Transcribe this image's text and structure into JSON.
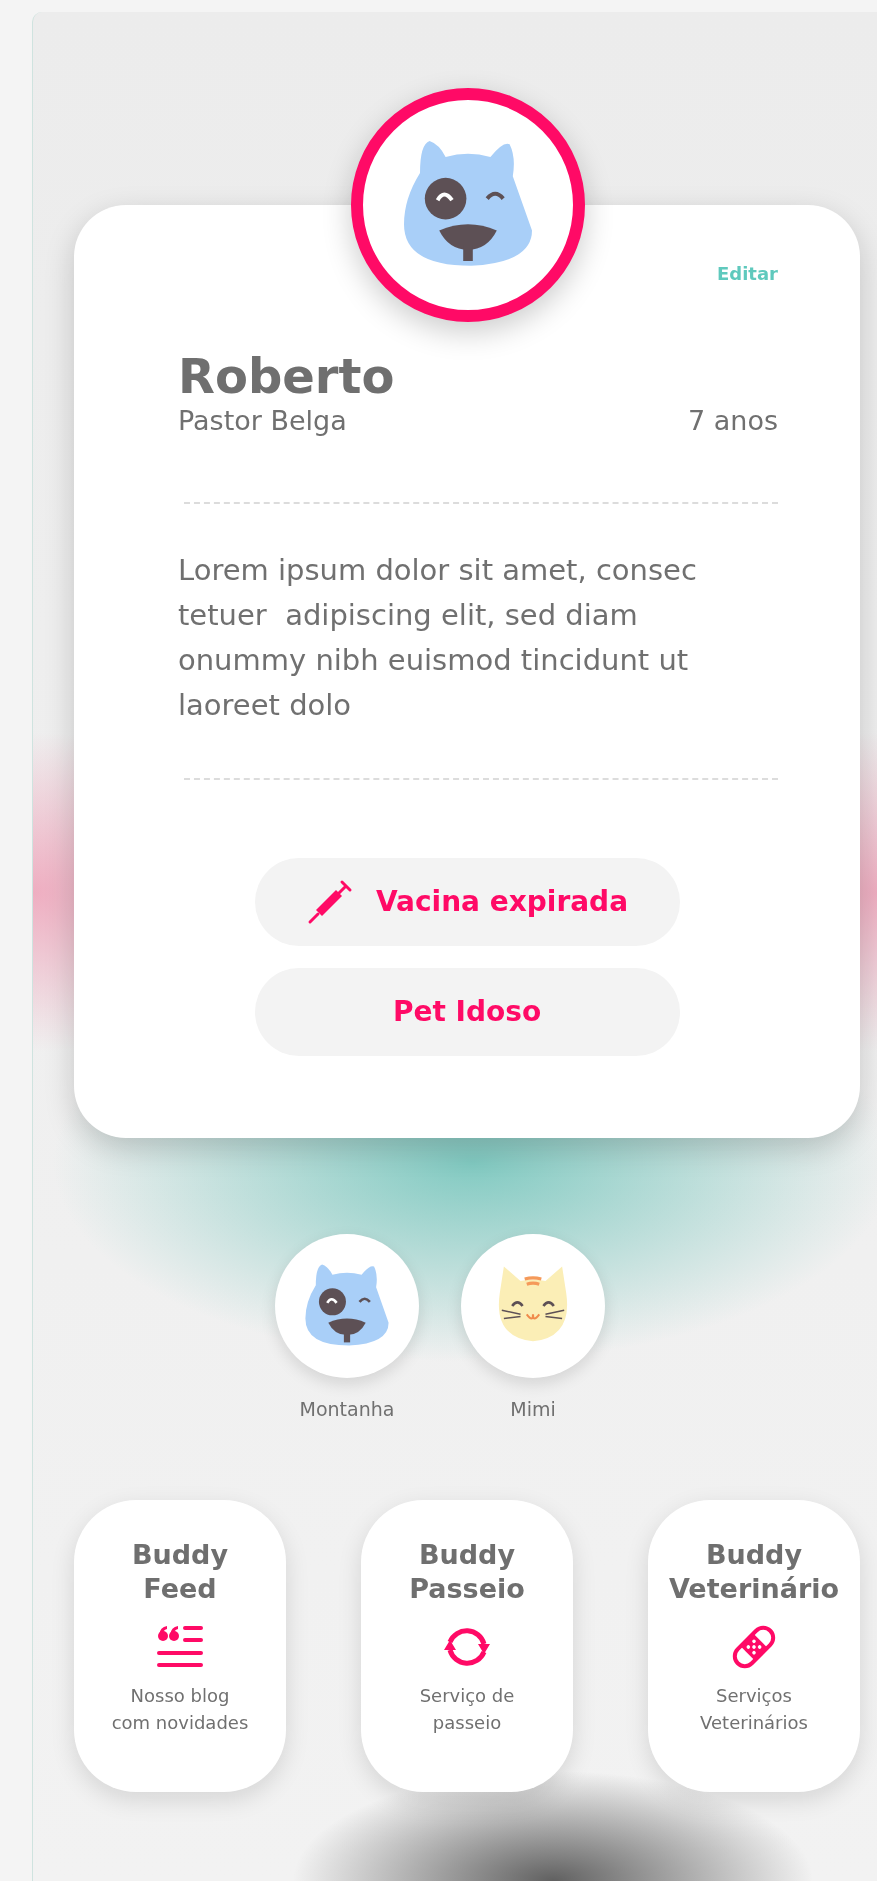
{
  "profile": {
    "avatar": {
      "kind": "dog"
    },
    "edit_link": "Editar",
    "name": "Roberto",
    "breed": "Pastor Belga",
    "age": "7 anos",
    "description": "Lorem ipsum dolor sit amet, consec tetuer  adipiscing elit, sed diam onummy nibh euismod tincidunt ut laoreet dolo",
    "tags": [
      {
        "label": "Vacina expirada",
        "kind": "vaccine"
      },
      {
        "label": "Pet Idoso",
        "kind": "plain"
      }
    ]
  },
  "pets": [
    {
      "name": "Montanha",
      "kind": "dog"
    },
    {
      "name": "Mimi",
      "kind": "cat"
    }
  ],
  "services": [
    {
      "title": "Buddy\nFeed",
      "description": "Nosso blog\ncom novidades",
      "kind": "blog"
    },
    {
      "title": "Buddy\nPasseio",
      "description": "Serviço de\npasseio",
      "kind": "walk"
    },
    {
      "title": "Buddy\nVeterinário",
      "description": "Serviços\nVeterinários",
      "kind": "vet"
    }
  ]
}
